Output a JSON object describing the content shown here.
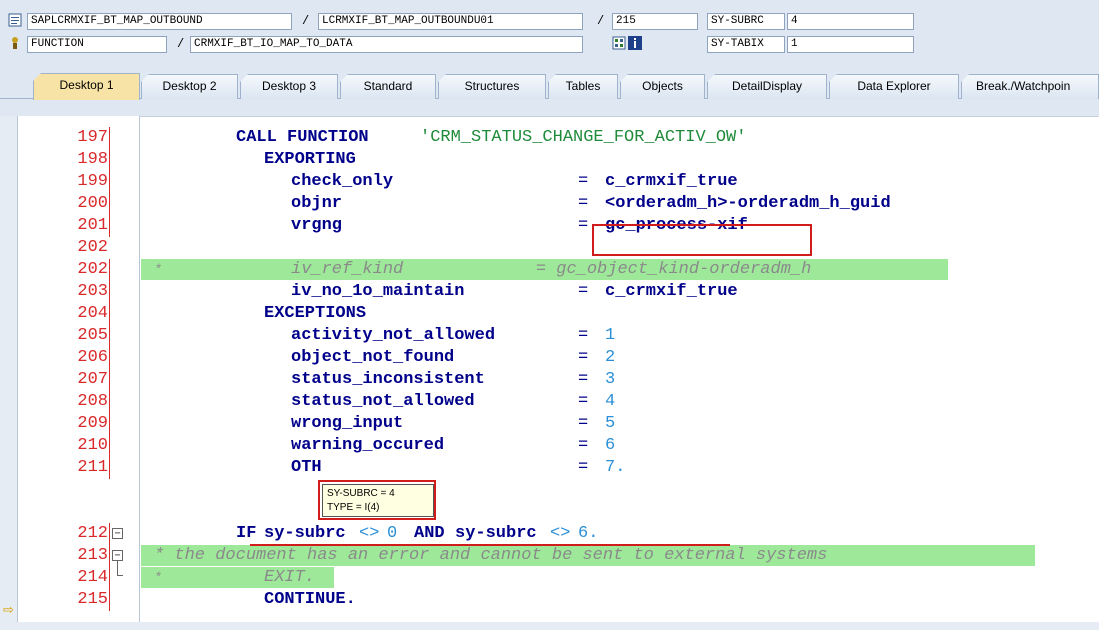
{
  "header": {
    "program": "SAPLCRMXIF_BT_MAP_OUTBOUND",
    "include": "LCRMXIF_BT_MAP_OUTBOUNDU01",
    "line": "215",
    "field1_name": "SY-SUBRC",
    "field1_value": "4",
    "event_type": "FUNCTION",
    "event_name": "CRMXIF_BT_IO_MAP_TO_DATA",
    "field2_name": "SY-TABIX",
    "field2_value": "1",
    "sep": "/"
  },
  "tabs": [
    {
      "label": "Desktop 1",
      "active": true
    },
    {
      "label": "Desktop 2"
    },
    {
      "label": "Desktop 3"
    },
    {
      "label": "Standard"
    },
    {
      "label": "Structures"
    },
    {
      "label": "Tables"
    },
    {
      "label": "Objects"
    },
    {
      "label": "DetailDisplay"
    },
    {
      "label": "Data Explorer"
    },
    {
      "label": "Break./Watchpoin"
    }
  ],
  "code": {
    "l197": {
      "num": "197",
      "kw": "CALL FUNCTION",
      "str": "'CRM_STATUS_CHANGE_FOR_ACTIV_OW'"
    },
    "l198": {
      "num": "198",
      "kw": "EXPORTING"
    },
    "l199": {
      "num": "199",
      "name": "check_only",
      "eq": "=",
      "val": "c_crmxif_true"
    },
    "l200": {
      "num": "200",
      "name": "objnr",
      "eq": "=",
      "val": "<orderadm_h>-orderadm_h_guid"
    },
    "l201": {
      "num": "201",
      "name": "vrgng",
      "eq": "=",
      "val": "gc_process-xif"
    },
    "l202": {
      "num": "202",
      "star": "*",
      "text": "iv_ref_kind             = gc_object_kind-orderadm_h"
    },
    "l203": {
      "num": "203",
      "name": "iv_no_1o_maintain",
      "eq": "=",
      "val": "c_crmxif_true"
    },
    "l204": {
      "num": "204",
      "kw": "EXCEPTIONS"
    },
    "l205": {
      "num": "205",
      "name": "activity_not_allowed",
      "eq": "=",
      "val": "1"
    },
    "l206": {
      "num": "206",
      "name": "object_not_found",
      "eq": "=",
      "val": "2"
    },
    "l207": {
      "num": "207",
      "name": "status_inconsistent",
      "eq": "=",
      "val": "3"
    },
    "l208": {
      "num": "208",
      "name": "status_not_allowed",
      "eq": "=",
      "val": "4"
    },
    "l209": {
      "num": "209",
      "name": "wrong_input",
      "eq": "=",
      "val": "5"
    },
    "l210": {
      "num": "210",
      "name": "warning_occured",
      "eq": "=",
      "val": "6"
    },
    "l211": {
      "num": "211",
      "name": "OTH",
      "eq": "=",
      "val": "7."
    },
    "l212": {
      "num": "212",
      "if": "IF",
      "a": "sy-subrc",
      "op": "<>",
      "n1": "0",
      "and": "AND",
      "b": "sy-subrc",
      "op2": "<>",
      "n2": "6."
    },
    "l213": {
      "num": "213",
      "text": "* the document has an error and cannot be sent to external systems"
    },
    "l214": {
      "num": "214",
      "star": "*",
      "text": "EXIT."
    },
    "l215": {
      "num": "215",
      "kw": "CONTINUE."
    }
  },
  "tooltip": {
    "line1": "SY-SUBRC = 4",
    "line2": "TYPE  = I(4)"
  },
  "colors": {
    "keyword": "#00008b",
    "string": "#1f8b3a",
    "number": "#2a8fd6",
    "line_number": "#d9292b",
    "comment_highlight": "#9ee89a",
    "annotation": "#d11c1c"
  }
}
